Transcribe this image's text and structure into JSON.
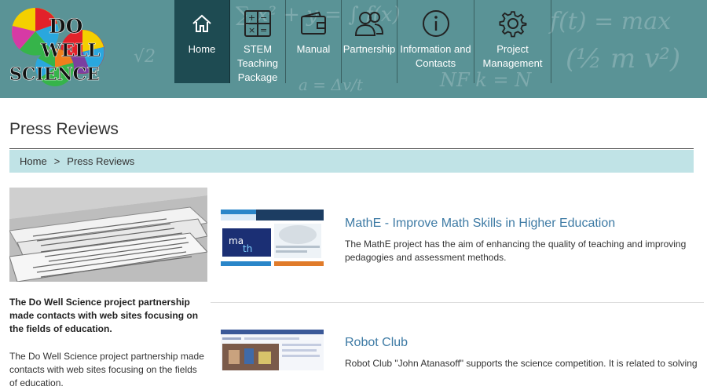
{
  "logo": {
    "line1": "DO",
    "line2": "WELL",
    "line3": "SCIENCE"
  },
  "nav": [
    {
      "label": "Home",
      "icon": "home-icon"
    },
    {
      "label": "STEM Teaching Package",
      "icon": "calculator-icon"
    },
    {
      "label": "Manual",
      "icon": "wallet-icon"
    },
    {
      "label": "Partnership",
      "icon": "users-icon"
    },
    {
      "label": "Information and Contacts",
      "icon": "info-icon"
    },
    {
      "label": "Project Management",
      "icon": "gear-icon"
    }
  ],
  "page_title": "Press Reviews",
  "breadcrumb": {
    "home": "Home",
    "separator": ">",
    "current": "Press Reviews"
  },
  "intro": {
    "bold": "The Do Well Science project partnership made contacts with web sites focusing on the fields of education.",
    "text": "The Do Well Science project partnership made contacts with web sites focusing on the fields of education."
  },
  "articles": [
    {
      "title": "MathE - Improve Math Skills in Higher Education",
      "description": "The MathE project has the aim of enhancing the quality of teaching and improving pedagogies and assessment methods."
    },
    {
      "title": "Robot Club",
      "description": "Robot Club \"John Atanasoff\" supports the science competition. It is related to solving"
    }
  ],
  "colors": {
    "header_bg": "#5a9396",
    "nav_active": "#1e4b52",
    "breadcrumb_bg": "#c0e3e6",
    "link": "#3d7aa4"
  }
}
